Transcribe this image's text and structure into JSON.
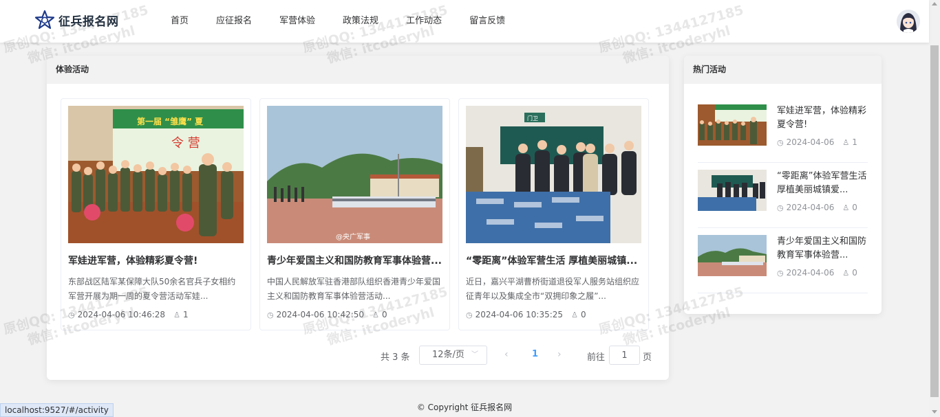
{
  "app": {
    "title": "征兵报名网",
    "nav": [
      "首页",
      "应征报名",
      "军营体验",
      "政策法规",
      "工作动态",
      "留言反馈"
    ]
  },
  "activities": {
    "heading": "体验活动",
    "cards": [
      {
        "title": "军娃进军营，体验精彩夏令营!",
        "desc": "东部战区陆军某保障大队50余名官兵子女相约军营开展为期一周的夏令营活动军娃...",
        "time": "2024-04-06 10:46:28",
        "views": "1"
      },
      {
        "title": "青少年爱国主义和国防教育军事体验营...",
        "desc": "中国人民解放军驻香港部队组织香港青少年爱国主义和国防教育军事体验营活动...",
        "time": "2024-04-06 10:42:50",
        "views": "0"
      },
      {
        "title": "“零距离”体验军营生活 厚植美丽城镇...",
        "desc": "近日，嘉兴平湖曹桥街道退役军人服务站组织应征青年以及集成全市“双拥印象之履”...",
        "time": "2024-04-06 10:35:25",
        "views": "0"
      }
    ]
  },
  "pagination": {
    "total": "共 3 条",
    "page_size": "12条/页",
    "current": "1",
    "goto_label": "前往",
    "goto_value": "1",
    "page_suffix": "页"
  },
  "hot": {
    "heading": "热门活动",
    "items": [
      {
        "title": "军娃进军营，体验精彩夏令营!",
        "date": "2024-04-06",
        "views": "1"
      },
      {
        "title": "“零距离”体验军营生活 厚植美丽城镇爱...",
        "date": "2024-04-06",
        "views": "0"
      },
      {
        "title": "青少年爱国主义和国防教育军事体验营...",
        "date": "2024-04-06",
        "views": "0"
      }
    ]
  },
  "image_texts": {
    "banner": "第一届 “雏鹰” 夏",
    "sign": "门卫",
    "weibo": "@央广军事"
  },
  "footer": "© Copyright 征兵报名网",
  "status_url": "localhost:9527/#/activity",
  "watermark": {
    "line1": "原创QQ: 1344127185",
    "line2": "微信: itcoderyhl"
  },
  "colors": {
    "accent": "#409eff",
    "logo_star": "#1e3a8a"
  }
}
